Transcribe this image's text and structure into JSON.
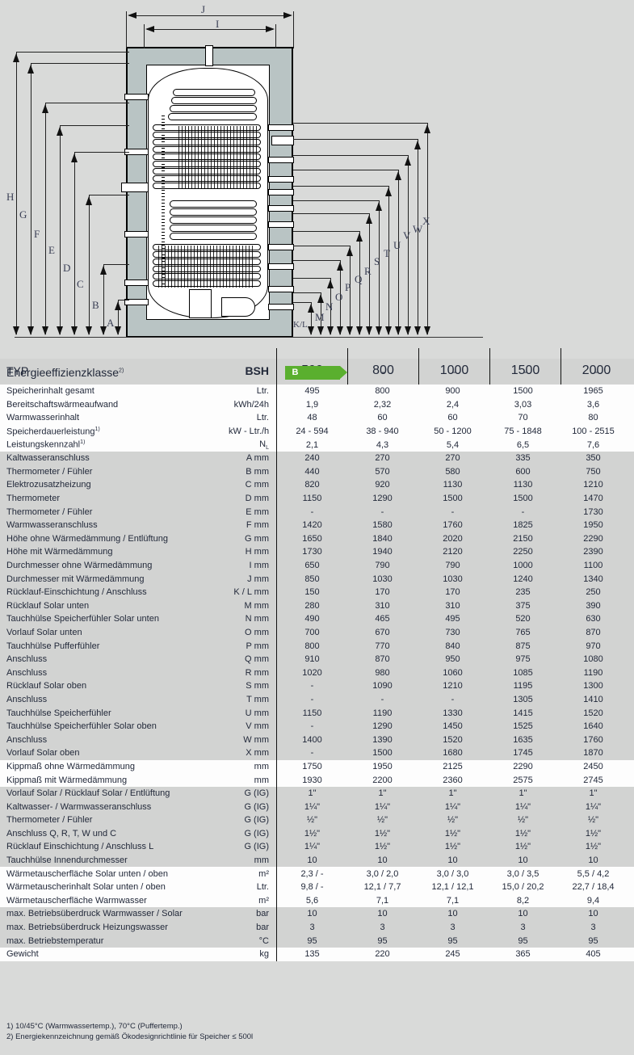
{
  "drawing": {
    "left_dimension_labels": [
      "H",
      "G",
      "F",
      "E",
      "D",
      "C",
      "B",
      "A"
    ],
    "top_dimension_labels": [
      "J",
      "I"
    ],
    "right_dimension_labels": [
      "K/L",
      "M",
      "N",
      "O",
      "P",
      "Q",
      "R",
      "S",
      "T",
      "U",
      "V",
      "W",
      "X"
    ]
  },
  "table": {
    "header": {
      "type_label": "TYP",
      "type_unit": "BSH",
      "models": [
        "500",
        "800",
        "1000",
        "1500",
        "2000"
      ],
      "efficiency_label": "Energieeffizienzklasse",
      "efficiency_sup": "2)",
      "efficiency_values": [
        "B",
        "-",
        "-",
        "-",
        "-"
      ],
      "efficiency_badge_color": "#5aaf2e"
    },
    "rows": [
      {
        "label": "Speicherinhalt gesamt",
        "sup": "",
        "unit": "Ltr.",
        "values": [
          "495",
          "800",
          "900",
          "1500",
          "1965"
        ],
        "band": "white"
      },
      {
        "label": "Bereitschaftswärmeaufwand",
        "sup": "",
        "unit": "kWh/24h",
        "values": [
          "1,9",
          "2,32",
          "2,4",
          "3,03",
          "3,6"
        ],
        "band": "white"
      },
      {
        "label": "Warmwasserinhalt",
        "sup": "",
        "unit": "Ltr.",
        "values": [
          "48",
          "60",
          "60",
          "70",
          "80"
        ],
        "band": "white"
      },
      {
        "label": "Speicherdauerleistung",
        "sup": "1)",
        "unit": "kW - Ltr./h",
        "values": [
          "24 - 594",
          "38 - 940",
          "50 - 1200",
          "75 - 1848",
          "100 - 2515"
        ],
        "band": "white"
      },
      {
        "label": "Leistungskennzahl",
        "sup": "1)",
        "unit": "N",
        "unit_sub": "L",
        "values": [
          "2,1",
          "4,3",
          "5,4",
          "6,5",
          "7,6"
        ],
        "band": "white"
      },
      {
        "label": "Kaltwasseranschluss",
        "sup": "",
        "unit": "A mm",
        "values": [
          "240",
          "270",
          "270",
          "335",
          "350"
        ],
        "band": "grey"
      },
      {
        "label": "Thermometer / Fühler",
        "sup": "",
        "unit": "B mm",
        "values": [
          "440",
          "570",
          "580",
          "600",
          "750"
        ],
        "band": "grey"
      },
      {
        "label": "Elektrozusatzheizung",
        "sup": "",
        "unit": "C mm",
        "values": [
          "820",
          "920",
          "1130",
          "1130",
          "1210"
        ],
        "band": "grey"
      },
      {
        "label": "Thermometer",
        "sup": "",
        "unit": "D mm",
        "values": [
          "1150",
          "1290",
          "1500",
          "1500",
          "1470"
        ],
        "band": "grey"
      },
      {
        "label": "Thermometer / Fühler",
        "sup": "",
        "unit": "E mm",
        "values": [
          "-",
          "-",
          "-",
          "-",
          "1730"
        ],
        "band": "grey"
      },
      {
        "label": "Warmwasseranschluss",
        "sup": "",
        "unit": "F mm",
        "values": [
          "1420",
          "1580",
          "1760",
          "1825",
          "1950"
        ],
        "band": "grey"
      },
      {
        "label": "Höhe ohne Wärmedämmung / Entlüftung",
        "sup": "",
        "unit": "G mm",
        "values": [
          "1650",
          "1840",
          "2020",
          "2150",
          "2290"
        ],
        "band": "grey"
      },
      {
        "label": "Höhe mit Wärmedämmung",
        "sup": "",
        "unit": "H mm",
        "values": [
          "1730",
          "1940",
          "2120",
          "2250",
          "2390"
        ],
        "band": "grey"
      },
      {
        "label": "Durchmesser ohne Wärmedämmung",
        "sup": "",
        "unit": "I mm",
        "values": [
          "650",
          "790",
          "790",
          "1000",
          "1100"
        ],
        "band": "grey"
      },
      {
        "label": "Durchmesser mit Wärmedämmung",
        "sup": "",
        "unit": "J mm",
        "values": [
          "850",
          "1030",
          "1030",
          "1240",
          "1340"
        ],
        "band": "grey"
      },
      {
        "label": "Rücklauf-Einschichtung / Anschluss",
        "sup": "",
        "unit": "K / L mm",
        "values": [
          "150",
          "170",
          "170",
          "235",
          "250"
        ],
        "band": "grey"
      },
      {
        "label": "Rücklauf Solar unten",
        "sup": "",
        "unit": "M mm",
        "values": [
          "280",
          "310",
          "310",
          "375",
          "390"
        ],
        "band": "grey"
      },
      {
        "label": "Tauchhülse Speicherfühler Solar unten",
        "sup": "",
        "unit": "N mm",
        "values": [
          "490",
          "465",
          "495",
          "520",
          "630"
        ],
        "band": "grey"
      },
      {
        "label": "Vorlauf Solar unten",
        "sup": "",
        "unit": "O mm",
        "values": [
          "700",
          "670",
          "730",
          "765",
          "870"
        ],
        "band": "grey"
      },
      {
        "label": "Tauchhülse Pufferfühler",
        "sup": "",
        "unit": "P mm",
        "values": [
          "800",
          "770",
          "840",
          "875",
          "970"
        ],
        "band": "grey"
      },
      {
        "label": "Anschluss",
        "sup": "",
        "unit": "Q mm",
        "values": [
          "910",
          "870",
          "950",
          "975",
          "1080"
        ],
        "band": "grey"
      },
      {
        "label": "Anschluss",
        "sup": "",
        "unit": "R mm",
        "values": [
          "1020",
          "980",
          "1060",
          "1085",
          "1190"
        ],
        "band": "grey"
      },
      {
        "label": "Rücklauf Solar oben",
        "sup": "",
        "unit": "S mm",
        "values": [
          "-",
          "1090",
          "1210",
          "1195",
          "1300"
        ],
        "band": "grey"
      },
      {
        "label": "Anschluss",
        "sup": "",
        "unit": "T mm",
        "values": [
          "-",
          "-",
          "-",
          "1305",
          "1410"
        ],
        "band": "grey"
      },
      {
        "label": "Tauchhülse Speicherfühler",
        "sup": "",
        "unit": "U mm",
        "values": [
          "1150",
          "1190",
          "1330",
          "1415",
          "1520"
        ],
        "band": "grey"
      },
      {
        "label": "Tauchhülse Speicherfühler Solar oben",
        "sup": "",
        "unit": "V mm",
        "values": [
          "-",
          "1290",
          "1450",
          "1525",
          "1640"
        ],
        "band": "grey"
      },
      {
        "label": "Anschluss",
        "sup": "",
        "unit": "W mm",
        "values": [
          "1400",
          "1390",
          "1520",
          "1635",
          "1760"
        ],
        "band": "grey"
      },
      {
        "label": "Vorlauf Solar oben",
        "sup": "",
        "unit": "X mm",
        "values": [
          "-",
          "1500",
          "1680",
          "1745",
          "1870"
        ],
        "band": "grey"
      },
      {
        "label": "Kippmaß ohne Wärmedämmung",
        "sup": "",
        "unit": "mm",
        "values": [
          "1750",
          "1950",
          "2125",
          "2290",
          "2450"
        ],
        "band": "white"
      },
      {
        "label": "Kippmaß mit Wärmedämmung",
        "sup": "",
        "unit": "mm",
        "values": [
          "1930",
          "2200",
          "2360",
          "2575",
          "2745"
        ],
        "band": "white"
      },
      {
        "label": "Vorlauf Solar / Rücklauf Solar / Entlüftung",
        "sup": "",
        "unit": "G (IG)",
        "values": [
          "1\"",
          "1\"",
          "1\"",
          "1\"",
          "1\""
        ],
        "band": "grey"
      },
      {
        "label": "Kaltwasser- / Warmwasseranschluss",
        "sup": "",
        "unit": "G (IG)",
        "values": [
          "1¼\"",
          "1¼\"",
          "1¼\"",
          "1¼\"",
          "1¼\""
        ],
        "band": "grey"
      },
      {
        "label": "Thermometer / Fühler",
        "sup": "",
        "unit": "G (IG)",
        "values": [
          "½\"",
          "½\"",
          "½\"",
          "½\"",
          "½\""
        ],
        "band": "grey"
      },
      {
        "label": "Anschluss Q, R, T, W und C",
        "sup": "",
        "unit": "G (IG)",
        "values": [
          "1½\"",
          "1½\"",
          "1½\"",
          "1½\"",
          "1½\""
        ],
        "band": "grey"
      },
      {
        "label": "Rücklauf Einschichtung / Anschluss L",
        "sup": "",
        "unit": "G (IG)",
        "values": [
          "1¼\"",
          "1½\"",
          "1½\"",
          "1½\"",
          "1½\""
        ],
        "band": "grey"
      },
      {
        "label": "Tauchhülse Innendurchmesser",
        "sup": "",
        "unit": "mm",
        "values": [
          "10",
          "10",
          "10",
          "10",
          "10"
        ],
        "band": "grey"
      },
      {
        "label": "Wärmetauscherfläche Solar unten / oben",
        "sup": "",
        "unit": "m²",
        "values": [
          "2,3 / -",
          "3,0 / 2,0",
          "3,0 / 3,0",
          "3,0 / 3,5",
          "5,5 / 4,2"
        ],
        "band": "white"
      },
      {
        "label": "Wärmetauscherinhalt Solar unten / oben",
        "sup": "",
        "unit": "Ltr.",
        "values": [
          "9,8 / -",
          "12,1 / 7,7",
          "12,1 / 12,1",
          "15,0 / 20,2",
          "22,7 / 18,4"
        ],
        "band": "white"
      },
      {
        "label": "Wärmetauscherfläche Warmwasser",
        "sup": "",
        "unit": "m²",
        "values": [
          "5,6",
          "7,1",
          "7,1",
          "8,2",
          "9,4"
        ],
        "band": "white"
      },
      {
        "label": "max. Betriebsüberdruck Warmwasser / Solar",
        "sup": "",
        "unit": "bar",
        "values": [
          "10",
          "10",
          "10",
          "10",
          "10"
        ],
        "band": "grey"
      },
      {
        "label": "max. Betriebsüberdruck Heizungswasser",
        "sup": "",
        "unit": "bar",
        "values": [
          "3",
          "3",
          "3",
          "3",
          "3"
        ],
        "band": "grey"
      },
      {
        "label": "max. Betriebstemperatur",
        "sup": "",
        "unit": "°C",
        "values": [
          "95",
          "95",
          "95",
          "95",
          "95"
        ],
        "band": "grey"
      },
      {
        "label": "Gewicht",
        "sup": "",
        "unit": "kg",
        "values": [
          "135",
          "220",
          "245",
          "365",
          "405"
        ],
        "band": "white"
      }
    ]
  },
  "footnotes": [
    "1) 10/45°C (Warmwassertemp.), 70°C (Puffertemp.)",
    "2) Energiekennzeichnung gemäß Ökodesignrichtlinie für Speicher ≤ 500l"
  ]
}
